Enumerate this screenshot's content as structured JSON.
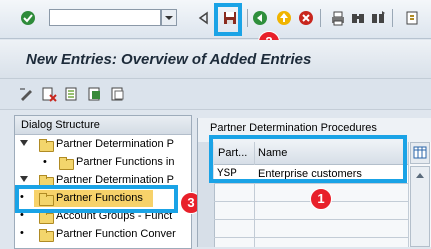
{
  "toolbar": {
    "command_field_value": "",
    "icons": [
      "enter-icon",
      "dropdown-icon",
      "back-triangle-icon",
      "save-icon",
      "back-icon",
      "exit-icon",
      "cancel-icon",
      "print-icon",
      "find-icon",
      "find-next-icon",
      "first-page-icon"
    ]
  },
  "title_bar": {
    "title": "New Entries: Overview of Added Entries"
  },
  "app_toolbar": {
    "icons": [
      "display-change-icon",
      "delete-icon",
      "copy-icon",
      "select-all-icon",
      "deselect-icon"
    ]
  },
  "dialog_structure": {
    "header": "Dialog Structure",
    "items": [
      {
        "label": "Partner Determination P",
        "level": 0,
        "expanded": true
      },
      {
        "label": "Partner Functions in",
        "level": 1
      },
      {
        "label": "Partner Determination P",
        "level": 0,
        "expanded": true
      },
      {
        "label": "Partner Functions",
        "level": 0,
        "selected": true
      },
      {
        "label": "Account Groups - Funct",
        "level": 0
      },
      {
        "label": "Partner Function Conver",
        "level": 0
      }
    ]
  },
  "procedures": {
    "title": "Partner Determination Procedures",
    "columns": [
      "Part...",
      "Name"
    ],
    "rows": [
      {
        "part": "YSP",
        "name": "Enterprise customers"
      }
    ]
  },
  "annotations": [
    "1",
    "2",
    "3"
  ],
  "colors": {
    "annotation_box": "#1aa3e6",
    "badge": "#e8202a",
    "selected_row": "#f7d26a"
  }
}
